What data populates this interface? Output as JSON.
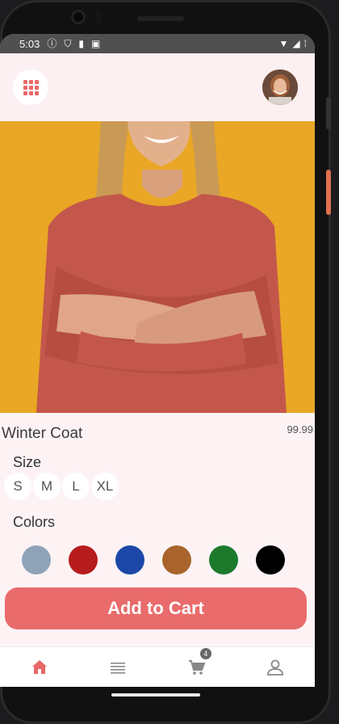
{
  "status_bar": {
    "time": "5:03",
    "left_icons": [
      "info-circle-icon",
      "shield-icon",
      "sd-card-icon",
      "image-icon"
    ],
    "right_icons": [
      "wifi-icon",
      "signal-icon",
      "battery-icon"
    ]
  },
  "header": {
    "menu_icon": "grid-icon",
    "avatar_icon": "profile-avatar"
  },
  "product": {
    "name": "Winter Coat",
    "price": "99.99",
    "size_label": "Size",
    "sizes": [
      "S",
      "M",
      "L",
      "XL"
    ],
    "colors_label": "Colors",
    "colors": [
      "#8fa3b8",
      "#b71c1c",
      "#1a47a8",
      "#a8642a",
      "#1d7a2c",
      "#000000"
    ]
  },
  "actions": {
    "add_to_cart": "Add to Cart"
  },
  "bottom_nav": {
    "items": [
      {
        "icon": "home-icon",
        "color": "#e86868"
      },
      {
        "icon": "list-icon",
        "color": "#888888"
      },
      {
        "icon": "cart-icon",
        "color": "#888888",
        "badge": "4"
      },
      {
        "icon": "person-icon",
        "color": "#888888"
      }
    ]
  },
  "colors": {
    "accent": "#e96b6b",
    "screen_bg": "#fdf3f5",
    "hero_bg": "#e9a725"
  }
}
